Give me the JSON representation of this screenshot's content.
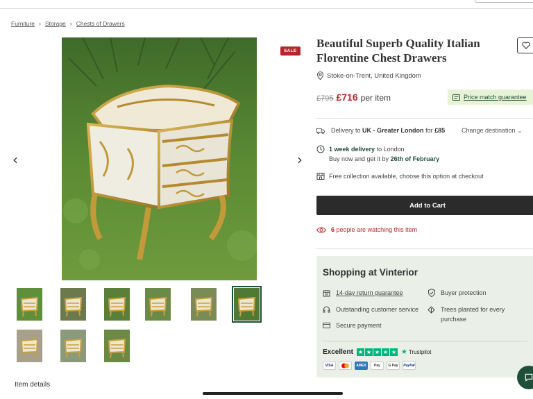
{
  "breadcrumb": {
    "items": [
      "Furniture",
      "Storage",
      "Chests of Drawers"
    ]
  },
  "gallery": {
    "sale_label": "SALE",
    "prev_icon": "chevron-left-icon",
    "next_icon": "chevron-right-icon",
    "thumbnail_count": 9,
    "selected_thumbnail": 6
  },
  "product": {
    "title": "Beautiful Superb Quality Italian Florentine Chest Drawers",
    "location": "Stoke-on-Trent, United Kingdom",
    "old_price": "£795",
    "new_price": "£716",
    "per_item": "per item",
    "price_match": "Price match guarantee"
  },
  "delivery": {
    "prefix": "Delivery to",
    "destination": "UK - Greater London",
    "for": "for",
    "cost": "£85",
    "change": "Change destination",
    "week_delivery": "1 week delivery",
    "to_london": "to London",
    "buy_now": "Buy now and get it by",
    "date": "26th of February",
    "collection": "Free collection available, choose this option at checkout"
  },
  "cart": {
    "add_label": "Add to Cart",
    "watching_count": "6",
    "watching_text": "people are watching this item"
  },
  "shopping": {
    "title": "Shopping at Vinterior",
    "features": [
      "14-day return guarantee",
      "Buyer protection",
      "Outstanding customer service",
      "Trees planted for every purchase",
      "Secure payment"
    ],
    "rating_label": "Excellent",
    "trustpilot": "Trustpilot",
    "payments": [
      "VISA",
      "MC",
      "AMEX",
      "Pay",
      "G Pay",
      "PayPal"
    ]
  },
  "footer": {
    "item_details": "Item details"
  },
  "colors": {
    "accent_red": "#b4282b",
    "dark_green": "#1f4e3a",
    "trustpilot_green": "#00b67a",
    "panel_bg": "#eaf0e8"
  }
}
